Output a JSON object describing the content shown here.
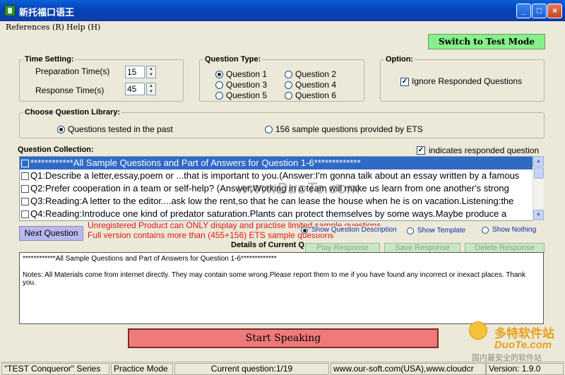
{
  "window": {
    "title": "新托福口语王",
    "minimize_glyph": "_",
    "maximize_glyph": "□",
    "close_glyph": "×"
  },
  "menu": {
    "references": "References (R)",
    "help": "Help (H)"
  },
  "switch_button": "Switch to Test Mode",
  "time_setting": {
    "legend": "Time Setting:",
    "preparation_label": "Preparation Time(s)",
    "preparation_value": "15",
    "response_label": "Response Time(s)",
    "response_value": "45"
  },
  "question_type": {
    "legend": "Question Type:",
    "options": [
      "Question 1",
      "Question 2",
      "Question 3",
      "Question 4",
      "Question 5",
      "Question 6"
    ],
    "selected": "Question 1"
  },
  "option": {
    "legend": "Option:",
    "ignore_responded": "Ignore Responded Questions",
    "ignore_checked": true
  },
  "library": {
    "legend": "Choose Question Library:",
    "past": "Questions tested in the past",
    "sample": "156 sample questions provided by ETS",
    "selected": "past"
  },
  "collection": {
    "label": "Question Collection:",
    "indicator": "indicates responded question",
    "items": [
      "************All Sample Questions and Part of Answers for Question 1-6*************",
      "Q1:Describe a letter,essay,poem or ...that is important to you.(Answer:I'm gonna talk about an essay written by a famous",
      "Q2:Prefer cooperation in a team or self-help? (Answer:Working in a team will make us learn from one another's strong",
      "Q3:Reading:A letter to the editor....ask low the rent,so that he can lease the house when he is on vacation.Listening:the",
      "Q4:Reading:Introduce one kind of predator saturation.Plants can protect themselves by some ways.Maybe produce a"
    ]
  },
  "next_button": "Next Question",
  "warning": {
    "line1": "Unregistered Product can ONLY display and practise limited sample questions",
    "line2": "Full version contains more than (455+156) ETS sample questions"
  },
  "display_mode": {
    "description": "Show Question Description",
    "template": "Show Template",
    "nothing": "Show Nothing",
    "selected": "description"
  },
  "details": {
    "heading": "Details of Current Q",
    "line1": "************All Sample Questions and Part of Answers for Question 1-6*************",
    "line2": "Notes: All Materials come from internet directly. They may contain some wrong.Please report them to me if you have found any incorrect or inexact places. Thank you."
  },
  "playback": {
    "play": "Play Response",
    "save": "Save Response",
    "delete": "Delete Response"
  },
  "start_button": "Start Speaking",
  "status": {
    "series": "\"TEST Conqueror\" Series",
    "mode": "Practice Mode",
    "current": "Current question:1/19",
    "site": "www.our-soft.com(USA),www.cloudcr",
    "version": "Version: 1.9.0"
  },
  "watermark": {
    "center": "www.DuoTe.com",
    "brand": "多特软件站",
    "brand_url": "DuoTe.com",
    "tagline": "国内最安全的软件站"
  }
}
